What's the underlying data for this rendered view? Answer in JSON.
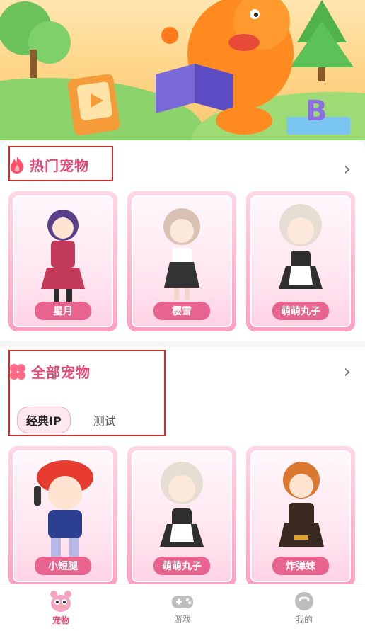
{
  "hot_section": {
    "title": "热门宠物",
    "pets": [
      {
        "name": "星月",
        "hair": "#5a3f8a",
        "dress": "#c43a5a"
      },
      {
        "name": "樱雪",
        "hair": "#d9c2b4",
        "dress": "#333333"
      },
      {
        "name": "萌萌丸子",
        "hair": "#e8ddd3",
        "dress": "#2f2f2f"
      }
    ]
  },
  "all_section": {
    "title": "全部宠物",
    "tabs": [
      {
        "label": "经典IP",
        "active": true
      },
      {
        "label": "测试",
        "active": false
      }
    ],
    "pets": [
      {
        "name": "小短腿",
        "hair": "#2b2b2b",
        "dress": "#2a3f8f"
      },
      {
        "name": "萌萌丸子",
        "hair": "#e8ddd3",
        "dress": "#2f2f2f"
      },
      {
        "name": "炸弹妹",
        "hair": "#d9782e",
        "dress": "#3a2a20"
      }
    ]
  },
  "bottom_nav": [
    {
      "label": "宠物",
      "icon": "pet-icon",
      "active": true
    },
    {
      "label": "游戏",
      "icon": "gamepad-icon",
      "active": false
    },
    {
      "label": "我的",
      "icon": "profile-icon",
      "active": false
    }
  ],
  "colors": {
    "accent": "#e84a78",
    "highlight_box": "#e02626"
  }
}
